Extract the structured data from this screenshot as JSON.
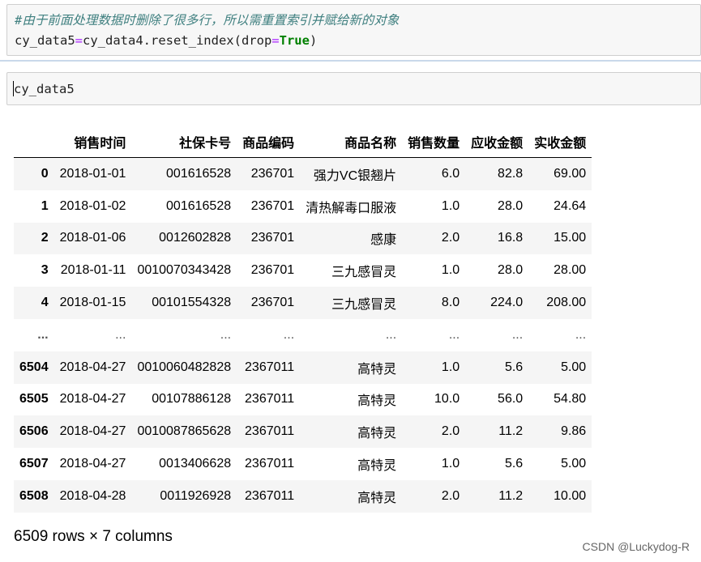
{
  "cell1": {
    "comment": "#由于前面处理数据时删除了很多行，所以需重置索引并赋给新的对象",
    "code_left": "cy_data5",
    "code_op1": "=",
    "code_mid": "cy_data4.reset_index(drop",
    "code_op2": "=",
    "code_kw": "True",
    "code_end": ")"
  },
  "cell2": {
    "input": "cy_data5"
  },
  "table": {
    "columns": [
      "",
      "销售时间",
      "社保卡号",
      "商品编码",
      "商品名称",
      "销售数量",
      "应收金额",
      "实收金额"
    ],
    "rows": [
      [
        "0",
        "2018-01-01",
        "001616528",
        "236701",
        "强力VC银翘片",
        "6.0",
        "82.8",
        "69.00"
      ],
      [
        "1",
        "2018-01-02",
        "001616528",
        "236701",
        "清热解毒口服液",
        "1.0",
        "28.0",
        "24.64"
      ],
      [
        "2",
        "2018-01-06",
        "0012602828",
        "236701",
        "感康",
        "2.0",
        "16.8",
        "15.00"
      ],
      [
        "3",
        "2018-01-11",
        "0010070343428",
        "236701",
        "三九感冒灵",
        "1.0",
        "28.0",
        "28.00"
      ],
      [
        "4",
        "2018-01-15",
        "00101554328",
        "236701",
        "三九感冒灵",
        "8.0",
        "224.0",
        "208.00"
      ],
      [
        "...",
        "...",
        "...",
        "...",
        "...",
        "...",
        "...",
        "..."
      ],
      [
        "6504",
        "2018-04-27",
        "0010060482828",
        "2367011",
        "高特灵",
        "1.0",
        "5.6",
        "5.00"
      ],
      [
        "6505",
        "2018-04-27",
        "00107886128",
        "2367011",
        "高特灵",
        "10.0",
        "56.0",
        "54.80"
      ],
      [
        "6506",
        "2018-04-27",
        "0010087865628",
        "2367011",
        "高特灵",
        "2.0",
        "11.2",
        "9.86"
      ],
      [
        "6507",
        "2018-04-27",
        "0013406628",
        "2367011",
        "高特灵",
        "1.0",
        "5.6",
        "5.00"
      ],
      [
        "6508",
        "2018-04-28",
        "0011926928",
        "2367011",
        "高特灵",
        "2.0",
        "11.2",
        "10.00"
      ]
    ]
  },
  "shape_note": "6509 rows × 7 columns",
  "watermark": "CSDN @Luckydog-R"
}
